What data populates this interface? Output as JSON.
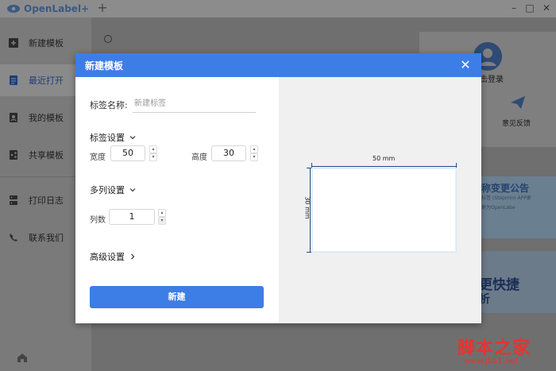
{
  "app": {
    "brand": "OpenLabel+",
    "new_tab": "+"
  },
  "window": {
    "minimize": "–",
    "maximize": "□",
    "close": "✕"
  },
  "sidebar": {
    "items": [
      {
        "label": "新建模板",
        "icon": "new-template-icon"
      },
      {
        "label": "最近打开",
        "icon": "recent-icon",
        "active": true
      },
      {
        "label": "我的模板",
        "icon": "my-templates-icon"
      },
      {
        "label": "共享模板",
        "icon": "shared-templates-icon"
      },
      {
        "label": "打印日志",
        "icon": "print-log-icon"
      },
      {
        "label": "联系我们",
        "icon": "contact-icon"
      }
    ]
  },
  "background": {
    "login": "击登录",
    "feedback": "意见反馈",
    "banner1_title": "称变更公告",
    "banner1_line1": "标签 (Stepmin) APP更",
    "banner1_line2": "更为OpenLabe",
    "banner2_title": "更快捷",
    "banner2_sub": "析"
  },
  "modal": {
    "title": "新建模板",
    "close": "✕",
    "name_label": "标签名称:",
    "name_placeholder": "新建标签",
    "label_settings": "标签设置",
    "width_label": "宽度",
    "width_value": "50",
    "height_label": "高度",
    "height_value": "30",
    "multi_column": "多列设置",
    "columns_label": "列数",
    "columns_value": "1",
    "advanced": "高级设置",
    "create_button": "新建"
  },
  "preview": {
    "width_text": "50 mm",
    "height_text": "30 mm"
  },
  "watermark": {
    "line1": "脚本之家",
    "line2": "www.jb51.net"
  },
  "colors": {
    "accent": "#3d7de6",
    "watermark": "#e3352f"
  }
}
